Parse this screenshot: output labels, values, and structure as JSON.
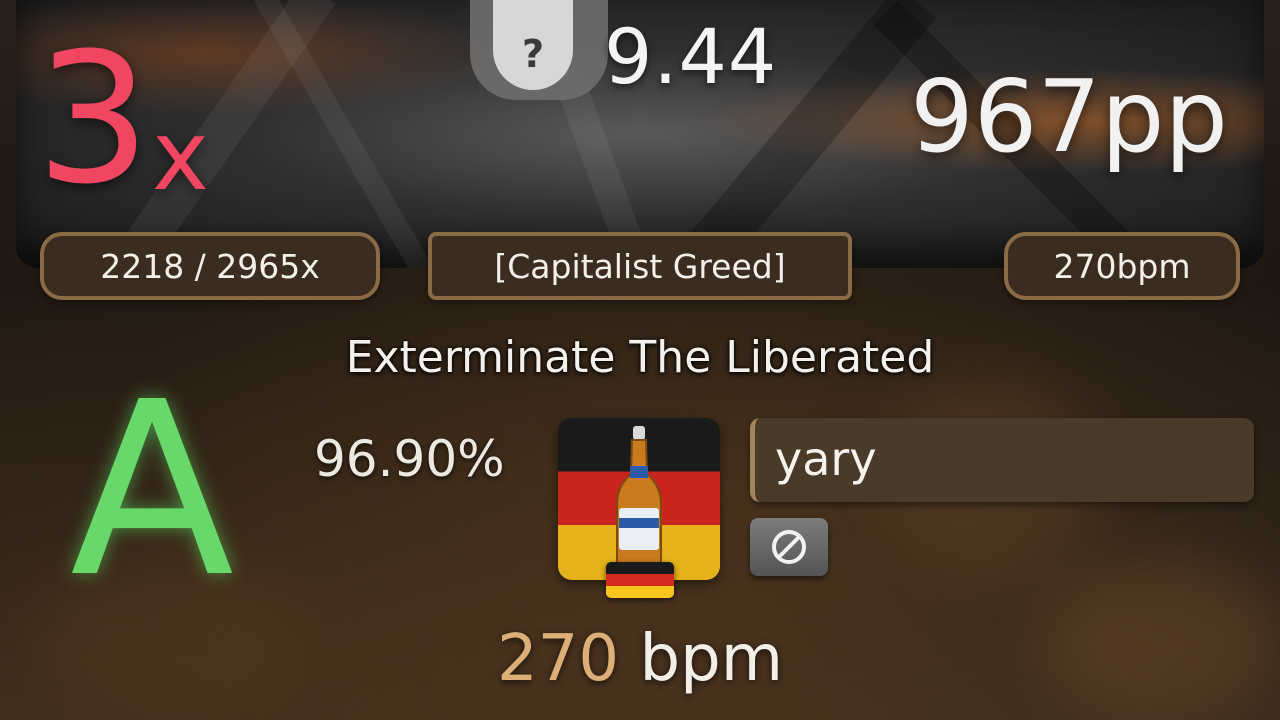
{
  "header": {
    "star_rating": "9.44",
    "unknown_badge": "?",
    "combo_multiplier_number": "3",
    "combo_multiplier_suffix": "x",
    "pp": "967pp"
  },
  "pills": {
    "combo": "2218 / 2965x",
    "difficulty": "[Capitalist Greed]",
    "bpm": "270bpm"
  },
  "song_title": "Exterminate The Liberated",
  "rank": "A",
  "accuracy": "96.90%",
  "player": {
    "username": "yary",
    "country": "Germany",
    "avatar_icon": "beer-bottle-on-german-flag",
    "mod_icon": "no-fail-mod-icon"
  },
  "bottom": {
    "bpm_value": "270",
    "bpm_unit": "bpm"
  },
  "colors": {
    "combo": "#f04661",
    "rank": "#68d86a",
    "pill_border": "#8b6b45",
    "bpm_accent": "#dcae78"
  }
}
